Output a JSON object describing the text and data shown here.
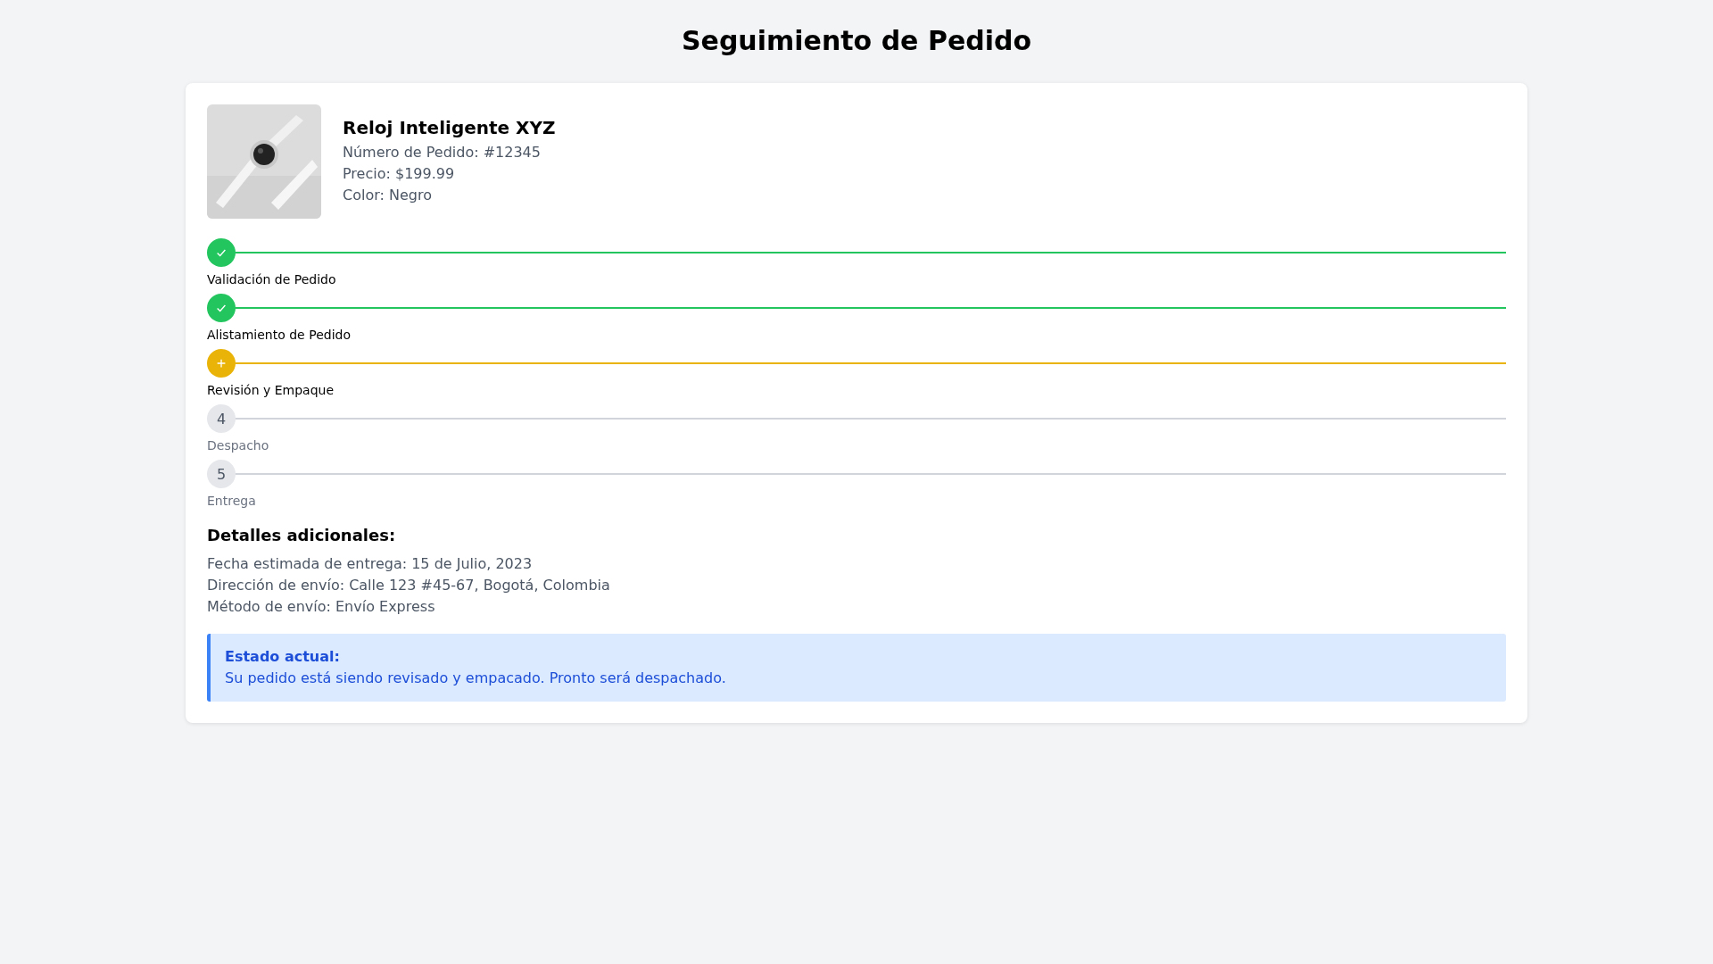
{
  "title": "Seguimiento de Pedido",
  "product": {
    "name": "Reloj Inteligente XYZ",
    "order": "Número de Pedido: #12345",
    "price": "Precio: $199.99",
    "color_label": "Color: Negro"
  },
  "steps": [
    {
      "label": "Validación de Pedido",
      "kind": "done"
    },
    {
      "label": "Alistamiento de Pedido",
      "kind": "done"
    },
    {
      "label": "Revisión y Empaque",
      "kind": "current"
    },
    {
      "label": "Despacho",
      "kind": "pending",
      "number": "4"
    },
    {
      "label": "Entrega",
      "kind": "pending",
      "number": "5"
    }
  ],
  "details": {
    "heading": "Detalles adicionales:",
    "lines": [
      "Fecha estimada de entrega: 15 de Julio, 2023",
      "Dirección de envío: Calle 123 #45-67, Bogotá, Colombia",
      "Método de envío: Envío Express"
    ]
  },
  "status_box": {
    "heading": "Estado actual:",
    "text": "Su pedido está siendo revisado y empacado. Pronto será despachado."
  }
}
